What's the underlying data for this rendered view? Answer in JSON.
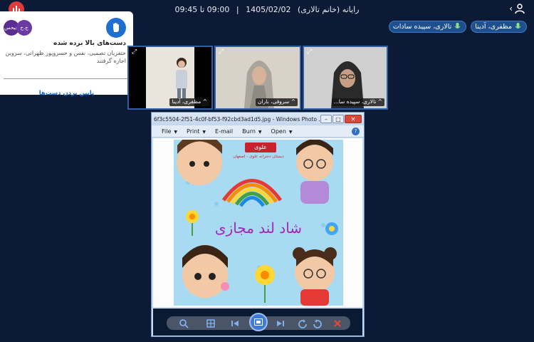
{
  "header": {
    "meeting_title": "رایانه (خانم تالاری)",
    "date": "1405/02/02",
    "separator": "|",
    "time_range": "09:00 تا 09:45",
    "colors": {
      "record": "#e03b3b",
      "background": "#0d1a36",
      "accent": "#1f6fd1"
    }
  },
  "speakers": [
    {
      "name": "مظفری، آدینا",
      "icon": "mic-icon"
    },
    {
      "name": "تالاری، سپیده سادات",
      "icon": "mic-icon"
    }
  ],
  "notification": {
    "avatars": [
      "ج.ح",
      "جیحس"
    ],
    "title": "دست‌های بالا برده شده",
    "body": "حتفریان تصمیی، نفس و حسروپور ظهرانی، سروین اجازه گرفتند",
    "action_label": "پایین بردن دست‌ها",
    "icon": "raised-hand-icon"
  },
  "tiles": [
    {
      "label": "^ مظفری، آدینا",
      "icon": "expand-icon"
    },
    {
      "label": "^ سروقی، باران",
      "icon": "expand-icon"
    },
    {
      "label": "^ تالاری، سپیده سا...",
      "icon": "expand-icon"
    }
  ],
  "viewer": {
    "window_title": "6f3c5504-2f51-4c0f-bf53-f92cbd3ad1d5.jpg - Windows Photo ...",
    "controls": {
      "minimize": "–",
      "maximize": "□",
      "close": "✕"
    },
    "menu": [
      {
        "label": "File",
        "dropdown": true
      },
      {
        "label": "Print",
        "dropdown": true
      },
      {
        "label": "E-mail",
        "dropdown": false
      },
      {
        "label": "Burn",
        "dropdown": true
      },
      {
        "label": "Open",
        "dropdown": true
      }
    ],
    "help": "?",
    "image": {
      "logo": "علوی",
      "subtitle": "دبستان دخترانه علوی - اصفهان",
      "headline": "شاد لند مجازی"
    }
  }
}
